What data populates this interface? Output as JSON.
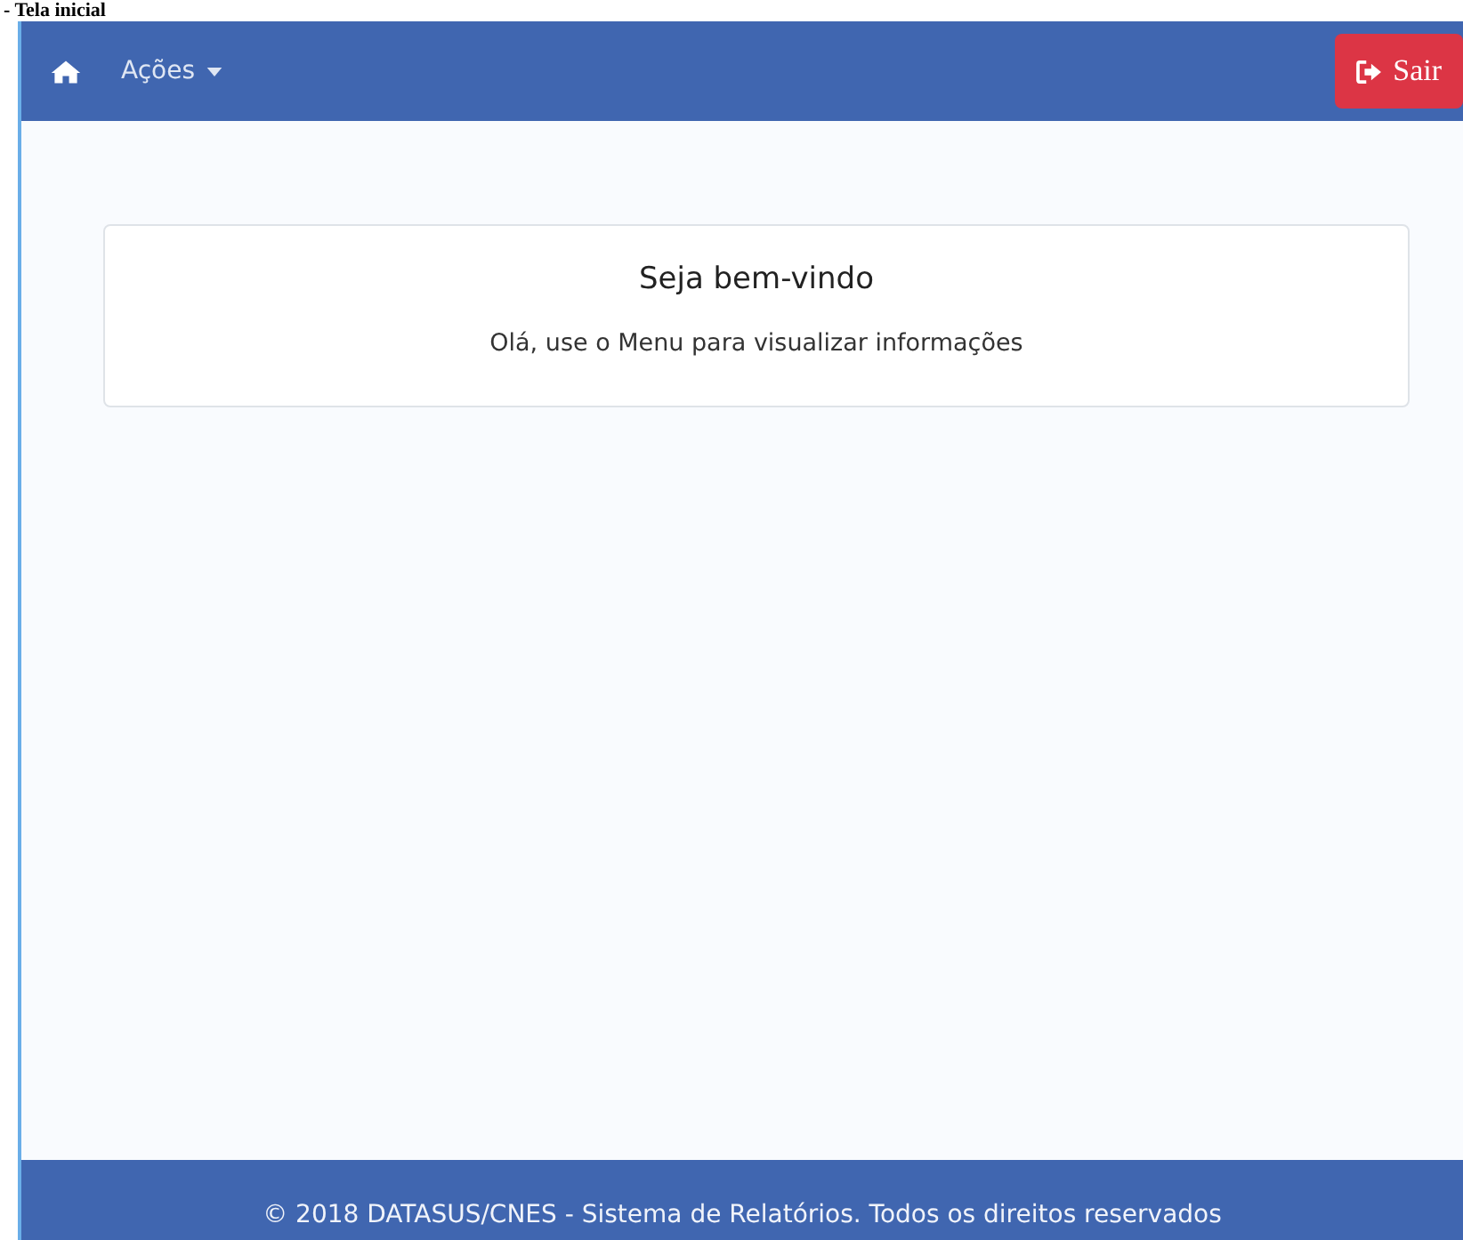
{
  "caption": "- Tela inicial",
  "navbar": {
    "menu": {
      "label": "Ações",
      "expanded": false
    },
    "logout": {
      "label": "Sair"
    }
  },
  "card": {
    "title": "Seja bem-vindo",
    "text": "Olá, use o Menu para visualizar informações"
  },
  "footer": "© 2018 DATASUS/CNES - Sistema de Relatórios. Todos os direitos reservados"
}
